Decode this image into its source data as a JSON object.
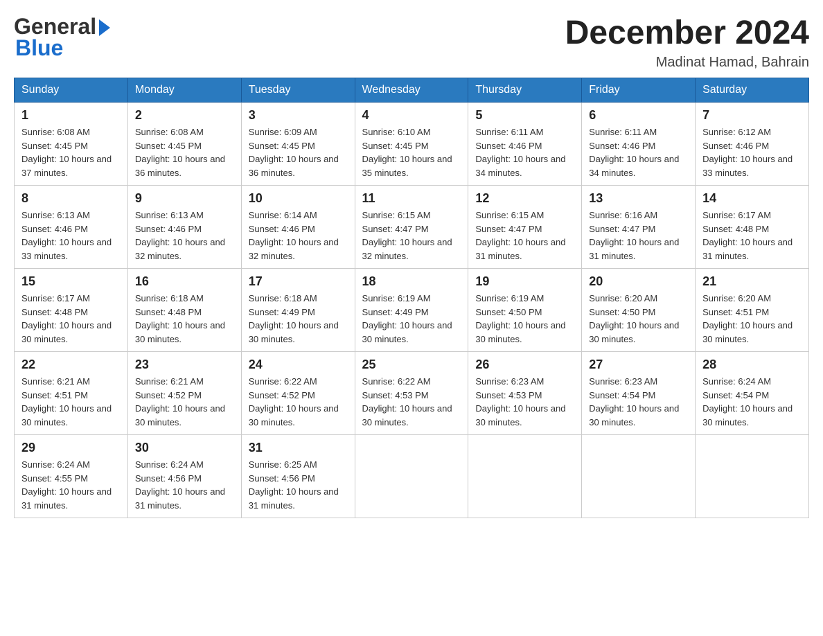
{
  "header": {
    "logo_general": "General",
    "logo_blue": "Blue",
    "month_year": "December 2024",
    "location": "Madinat Hamad, Bahrain"
  },
  "weekdays": [
    "Sunday",
    "Monday",
    "Tuesday",
    "Wednesday",
    "Thursday",
    "Friday",
    "Saturday"
  ],
  "weeks": [
    [
      {
        "day": "1",
        "sunrise": "6:08 AM",
        "sunset": "4:45 PM",
        "daylight": "10 hours and 37 minutes."
      },
      {
        "day": "2",
        "sunrise": "6:08 AM",
        "sunset": "4:45 PM",
        "daylight": "10 hours and 36 minutes."
      },
      {
        "day": "3",
        "sunrise": "6:09 AM",
        "sunset": "4:45 PM",
        "daylight": "10 hours and 36 minutes."
      },
      {
        "day": "4",
        "sunrise": "6:10 AM",
        "sunset": "4:45 PM",
        "daylight": "10 hours and 35 minutes."
      },
      {
        "day": "5",
        "sunrise": "6:11 AM",
        "sunset": "4:46 PM",
        "daylight": "10 hours and 34 minutes."
      },
      {
        "day": "6",
        "sunrise": "6:11 AM",
        "sunset": "4:46 PM",
        "daylight": "10 hours and 34 minutes."
      },
      {
        "day": "7",
        "sunrise": "6:12 AM",
        "sunset": "4:46 PM",
        "daylight": "10 hours and 33 minutes."
      }
    ],
    [
      {
        "day": "8",
        "sunrise": "6:13 AM",
        "sunset": "4:46 PM",
        "daylight": "10 hours and 33 minutes."
      },
      {
        "day": "9",
        "sunrise": "6:13 AM",
        "sunset": "4:46 PM",
        "daylight": "10 hours and 32 minutes."
      },
      {
        "day": "10",
        "sunrise": "6:14 AM",
        "sunset": "4:46 PM",
        "daylight": "10 hours and 32 minutes."
      },
      {
        "day": "11",
        "sunrise": "6:15 AM",
        "sunset": "4:47 PM",
        "daylight": "10 hours and 32 minutes."
      },
      {
        "day": "12",
        "sunrise": "6:15 AM",
        "sunset": "4:47 PM",
        "daylight": "10 hours and 31 minutes."
      },
      {
        "day": "13",
        "sunrise": "6:16 AM",
        "sunset": "4:47 PM",
        "daylight": "10 hours and 31 minutes."
      },
      {
        "day": "14",
        "sunrise": "6:17 AM",
        "sunset": "4:48 PM",
        "daylight": "10 hours and 31 minutes."
      }
    ],
    [
      {
        "day": "15",
        "sunrise": "6:17 AM",
        "sunset": "4:48 PM",
        "daylight": "10 hours and 30 minutes."
      },
      {
        "day": "16",
        "sunrise": "6:18 AM",
        "sunset": "4:48 PM",
        "daylight": "10 hours and 30 minutes."
      },
      {
        "day": "17",
        "sunrise": "6:18 AM",
        "sunset": "4:49 PM",
        "daylight": "10 hours and 30 minutes."
      },
      {
        "day": "18",
        "sunrise": "6:19 AM",
        "sunset": "4:49 PM",
        "daylight": "10 hours and 30 minutes."
      },
      {
        "day": "19",
        "sunrise": "6:19 AM",
        "sunset": "4:50 PM",
        "daylight": "10 hours and 30 minutes."
      },
      {
        "day": "20",
        "sunrise": "6:20 AM",
        "sunset": "4:50 PM",
        "daylight": "10 hours and 30 minutes."
      },
      {
        "day": "21",
        "sunrise": "6:20 AM",
        "sunset": "4:51 PM",
        "daylight": "10 hours and 30 minutes."
      }
    ],
    [
      {
        "day": "22",
        "sunrise": "6:21 AM",
        "sunset": "4:51 PM",
        "daylight": "10 hours and 30 minutes."
      },
      {
        "day": "23",
        "sunrise": "6:21 AM",
        "sunset": "4:52 PM",
        "daylight": "10 hours and 30 minutes."
      },
      {
        "day": "24",
        "sunrise": "6:22 AM",
        "sunset": "4:52 PM",
        "daylight": "10 hours and 30 minutes."
      },
      {
        "day": "25",
        "sunrise": "6:22 AM",
        "sunset": "4:53 PM",
        "daylight": "10 hours and 30 minutes."
      },
      {
        "day": "26",
        "sunrise": "6:23 AM",
        "sunset": "4:53 PM",
        "daylight": "10 hours and 30 minutes."
      },
      {
        "day": "27",
        "sunrise": "6:23 AM",
        "sunset": "4:54 PM",
        "daylight": "10 hours and 30 minutes."
      },
      {
        "day": "28",
        "sunrise": "6:24 AM",
        "sunset": "4:54 PM",
        "daylight": "10 hours and 30 minutes."
      }
    ],
    [
      {
        "day": "29",
        "sunrise": "6:24 AM",
        "sunset": "4:55 PM",
        "daylight": "10 hours and 31 minutes."
      },
      {
        "day": "30",
        "sunrise": "6:24 AM",
        "sunset": "4:56 PM",
        "daylight": "10 hours and 31 minutes."
      },
      {
        "day": "31",
        "sunrise": "6:25 AM",
        "sunset": "4:56 PM",
        "daylight": "10 hours and 31 minutes."
      },
      null,
      null,
      null,
      null
    ]
  ]
}
